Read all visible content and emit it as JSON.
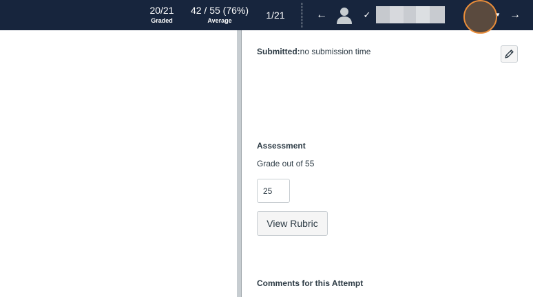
{
  "header": {
    "graded": {
      "value": "20/21",
      "label": "Graded"
    },
    "average": {
      "value": "42 / 55 (76%)",
      "label": "Average"
    },
    "position": "1/21",
    "prev_arrow": "←",
    "next_arrow": "→",
    "check_glyph": "✓",
    "caret_glyph": "▼"
  },
  "submission": {
    "submitted_label": "Submitted:",
    "submitted_value": "no submission time"
  },
  "assessment": {
    "title": "Assessment",
    "grade_label": "Grade out of 55",
    "grade_value": "25",
    "rubric_button": "View Rubric"
  },
  "comments": {
    "title": "Comments for this Attempt"
  },
  "icons": {
    "avatar": "user-avatar-icon",
    "check": "checkmark-icon",
    "edit": "pencil-icon",
    "prev": "arrow-left-icon",
    "next": "arrow-right-icon"
  },
  "colors": {
    "header_bg": "#17253d",
    "accent_ring": "#e98d3a",
    "text": "#2d3b45"
  }
}
